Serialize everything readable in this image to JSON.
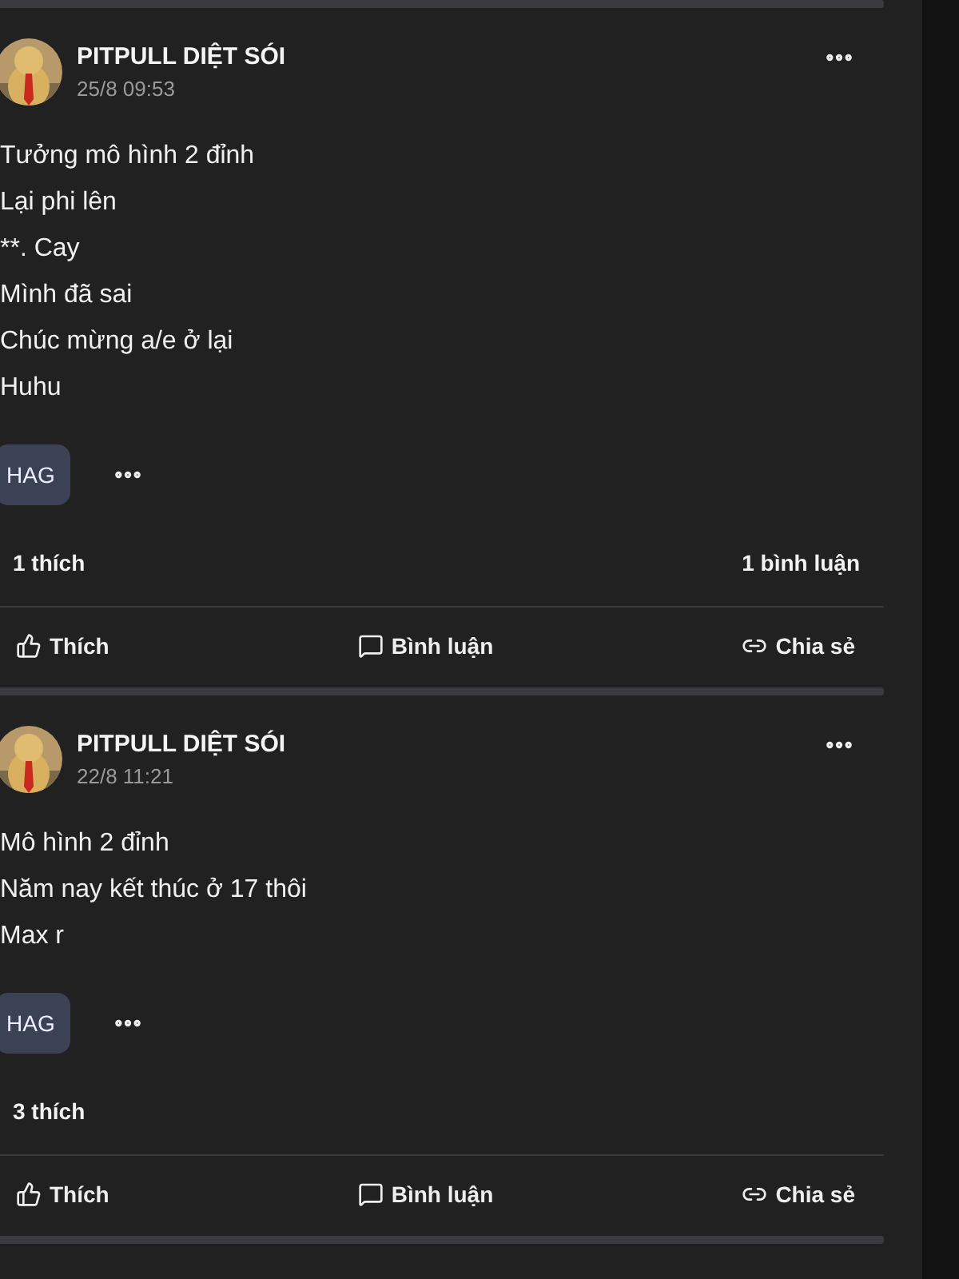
{
  "posts": [
    {
      "author": "PITPULL DIỆT SÓI",
      "time": "25/8 09:53",
      "lines": [
        "Tưởng mô hình 2 đỉnh",
        "Lại phi lên",
        "**. Cay",
        "Mình đã sai",
        "Chúc mừng a/e ở lại",
        "Huhu"
      ],
      "tags": [
        "HAG"
      ],
      "likes": "1 thích",
      "comments": "1 bình luận",
      "actions": [
        {
          "kind": "like",
          "label": "Thích"
        },
        {
          "kind": "comment",
          "label": "Bình luận"
        },
        {
          "kind": "share",
          "label": "Chia sẻ"
        }
      ]
    },
    {
      "author": "PITPULL DIỆT SÓI",
      "time": "22/8 11:21",
      "lines": [
        "Mô hình 2 đỉnh",
        "Năm nay kết thúc ở 17 thôi",
        "Max r"
      ],
      "tags": [
        "HAG"
      ],
      "likes": "3 thích",
      "actions": [
        {
          "kind": "like",
          "label": "Thích"
        },
        {
          "kind": "comment",
          "label": "Bình luận"
        },
        {
          "kind": "share",
          "label": "Chia sẻ"
        }
      ]
    }
  ]
}
